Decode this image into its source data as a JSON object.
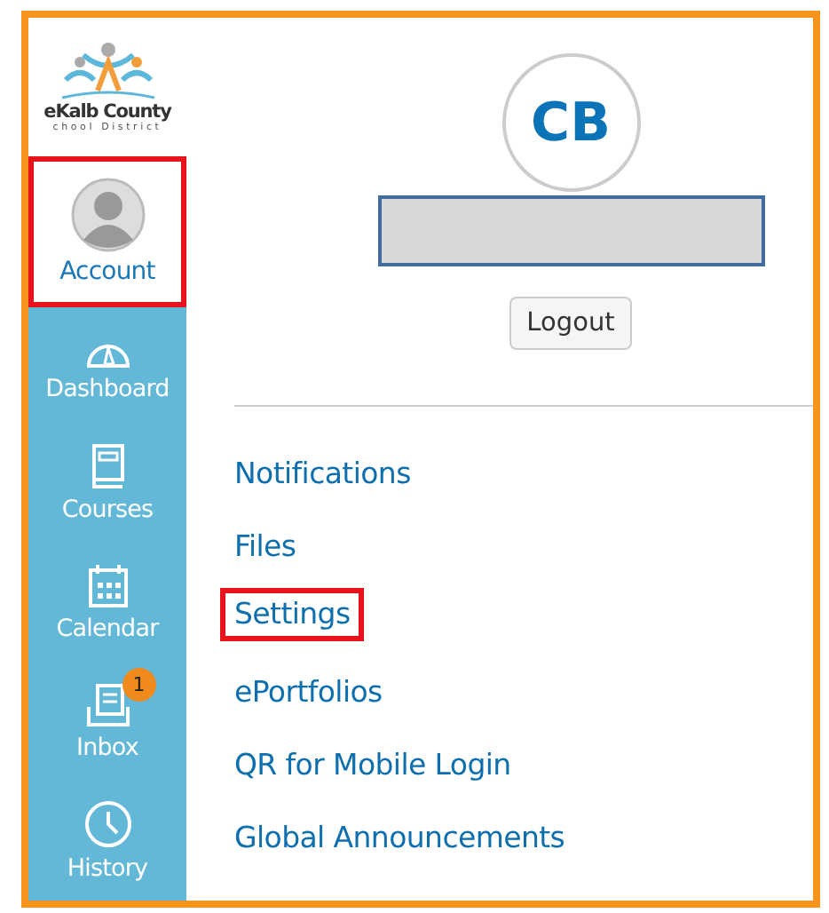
{
  "logo": {
    "name": "eKalb County",
    "subtitle": "chool District"
  },
  "nav": [
    {
      "kind": "account",
      "label": "Account",
      "selected": true,
      "highlighted": true
    },
    {
      "kind": "dashboard",
      "label": "Dashboard",
      "selected": false,
      "highlighted": false
    },
    {
      "kind": "courses",
      "label": "Courses",
      "selected": false,
      "highlighted": false
    },
    {
      "kind": "calendar",
      "label": "Calendar",
      "selected": false,
      "highlighted": false
    },
    {
      "kind": "inbox",
      "label": "Inbox",
      "selected": false,
      "highlighted": false,
      "badge": "1"
    },
    {
      "kind": "history",
      "label": "History",
      "selected": false,
      "highlighted": false
    }
  ],
  "profile": {
    "initials": "CB",
    "logout": "Logout"
  },
  "links": [
    {
      "label": "Notifications",
      "highlighted": false
    },
    {
      "label": "Files",
      "highlighted": false
    },
    {
      "label": "Settings",
      "highlighted": true
    },
    {
      "label": "ePortfolios",
      "highlighted": false
    },
    {
      "label": "QR for Mobile Login",
      "highlighted": false
    },
    {
      "label": "Global Announcements",
      "highlighted": false
    }
  ]
}
